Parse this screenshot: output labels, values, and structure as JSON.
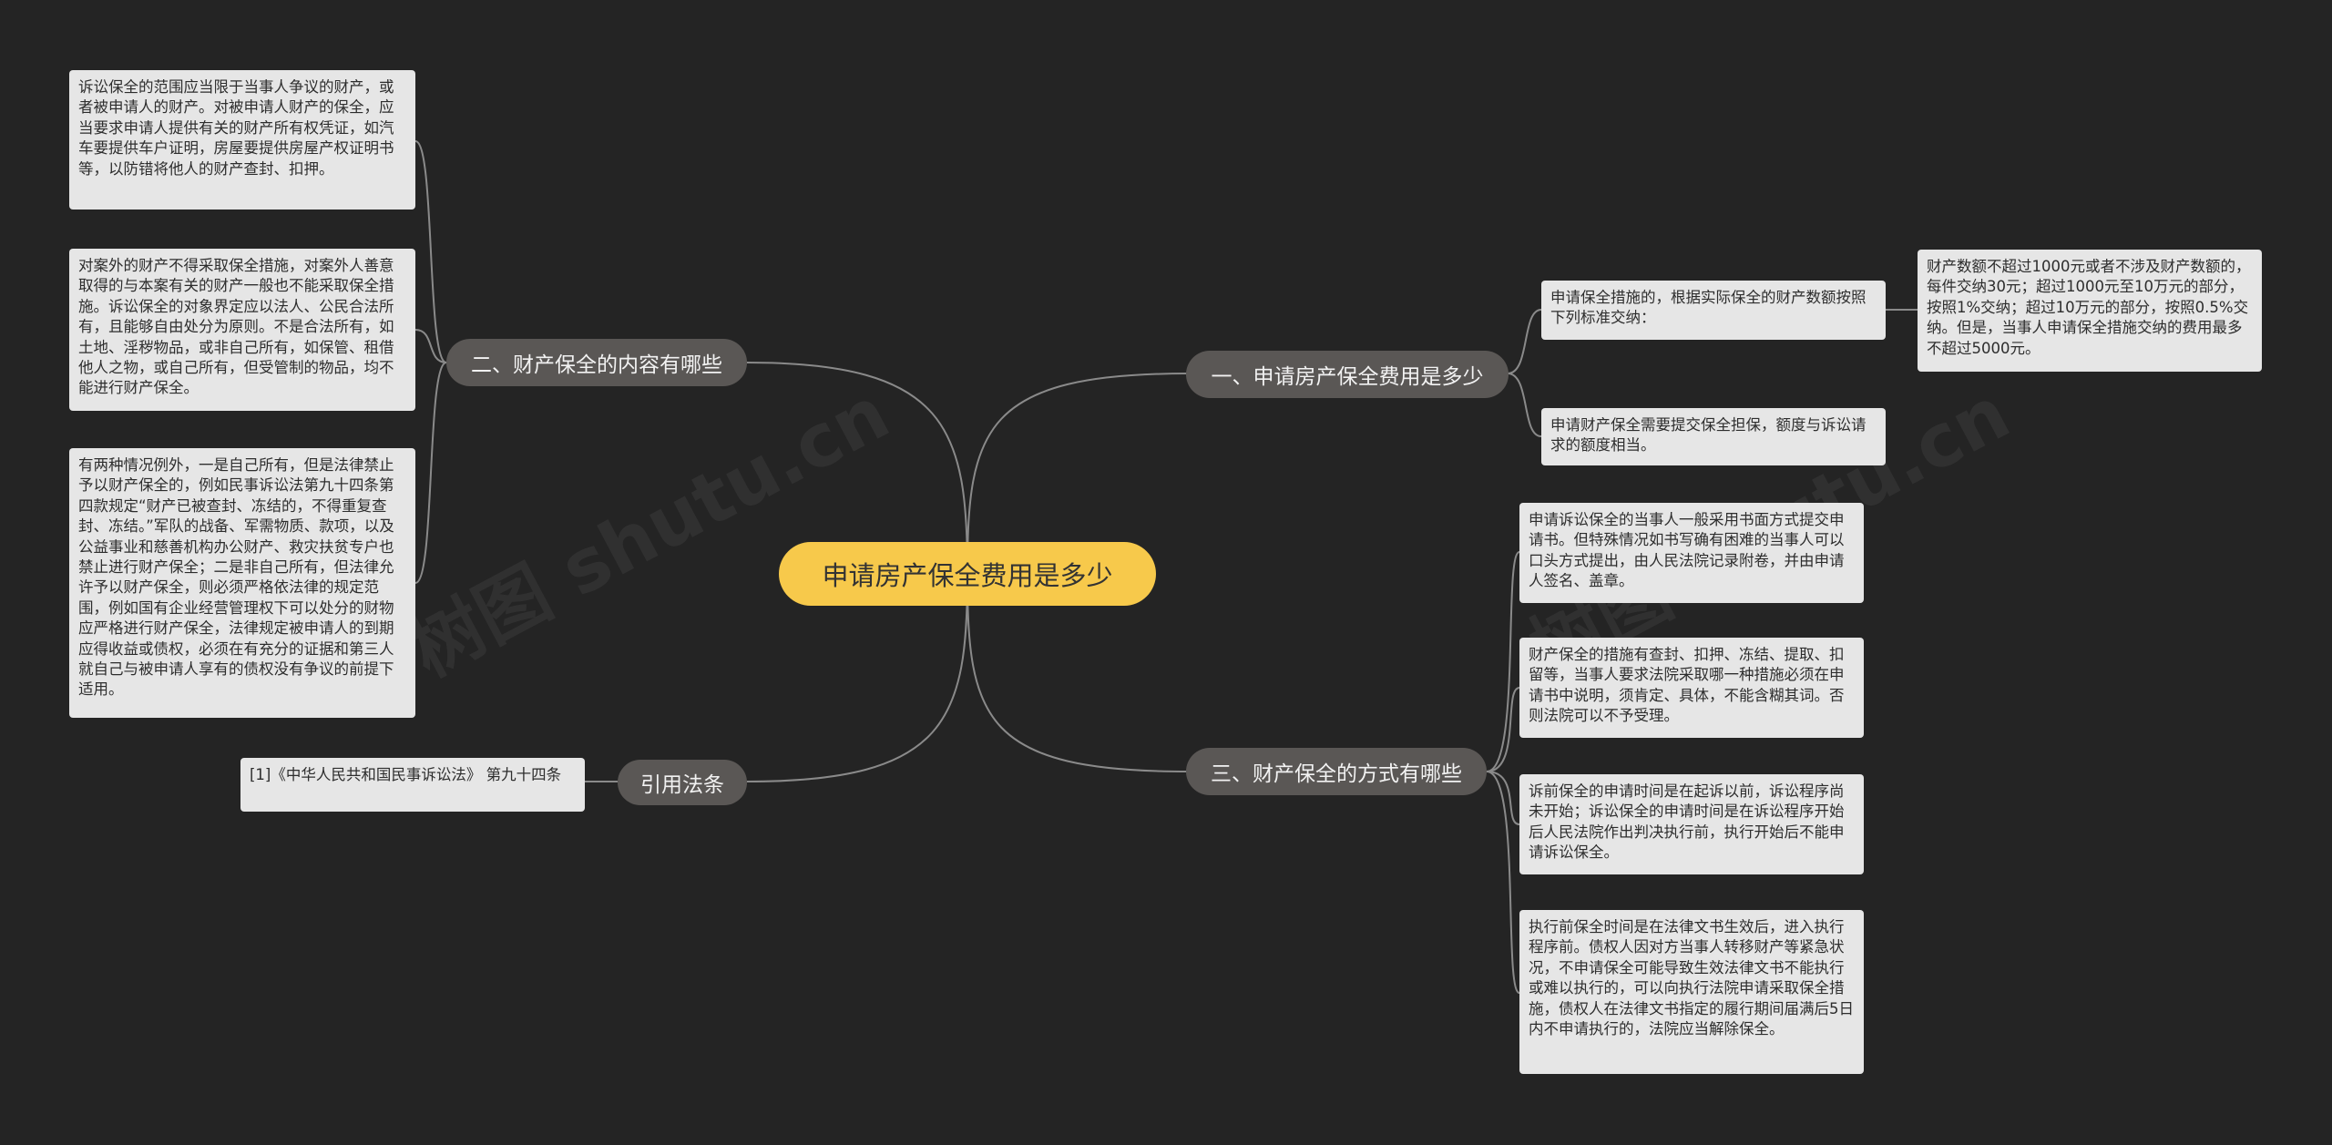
{
  "root": "申请房产保全费用是多少",
  "branches": {
    "b1": {
      "label": "一、申请房产保全费用是多少",
      "leaves": [
        "申请保全措施的，根据实际保全的财产数额按照下列标准交纳：",
        "申请财产保全需要提交保全担保，额度与诉讼请求的额度相当。"
      ],
      "sub": "财产数额不超过1000元或者不涉及财产数额的，每件交纳30元；超过1000元至10万元的部分，按照1%交纳；超过10万元的部分，按照0.5%交纳。但是，当事人申请保全措施交纳的费用最多不超过5000元。"
    },
    "b2": {
      "label": "二、财产保全的内容有哪些",
      "leaves": [
        "诉讼保全的范围应当限于当事人争议的财产，或者被申请人的财产。对被申请人财产的保全，应当要求申请人提供有关的财产所有权凭证，如汽车要提供车户证明，房屋要提供房屋产权证明书等，以防错将他人的财产查封、扣押。",
        "对案外的财产不得采取保全措施，对案外人善意取得的与本案有关的财产一般也不能采取保全措施。诉讼保全的对象界定应以法人、公民合法所有，且能够自由处分为原则。不是合法所有，如土地、淫秽物品，或非自己所有，如保管、租借他人之物，或自己所有，但受管制的物品，均不能进行财产保全。",
        "有两种情况例外，一是自己所有，但是法律禁止予以财产保全的，例如民事诉讼法第九十四条第四款规定“财产已被查封、冻结的，不得重复查封、冻结。”军队的战备、军需物质、款项，以及公益事业和慈善机构办公财产、救灾扶贫专户也禁止进行财产保全；二是非自己所有，但法律允许予以财产保全，则必须严格依法律的规定范围，例如国有企业经营管理权下可以处分的财物应严格进行财产保全，法律规定被申请人的到期应得收益或债权，必须在有充分的证据和第三人就自己与被申请人享有的债权没有争议的前提下适用。"
      ]
    },
    "b3": {
      "label": "三、财产保全的方式有哪些",
      "leaves": [
        "申请诉讼保全的当事人一般采用书面方式提交申请书。但特殊情况如书写确有困难的当事人可以口头方式提出，由人民法院记录附卷，并由申请人签名、盖章。",
        "财产保全的措施有查封、扣押、冻结、提取、扣留等，当事人要求法院采取哪一种措施必须在申请书中说明，须肯定、具体，不能含糊其词。否则法院可以不予受理。",
        "诉前保全的申请时间是在起诉以前，诉讼程序尚未开始；诉讼保全的申请时间是在诉讼程序开始后人民法院作出判决执行前，执行开始后不能申请诉讼保全。",
        "执行前保全时间是在法律文书生效后，进入执行程序前。债权人因对方当事人转移财产等紧急状况，不申请保全可能导致生效法律文书不能执行或难以执行的，可以向执行法院申请采取保全措施，债权人在法律文书指定的履行期间届满后5日内不申请执行的，法院应当解除保全。"
      ]
    },
    "b4": {
      "label": "引用法条",
      "leaves": [
        "[1]《中华人民共和国民事诉讼法》 第九十四条"
      ]
    }
  },
  "colors": {
    "background": "#242424",
    "root_fill": "#f7c94b",
    "branch_fill": "#5a5755",
    "leaf_fill": "#e6e6e6",
    "link": "#8a8a8a"
  }
}
